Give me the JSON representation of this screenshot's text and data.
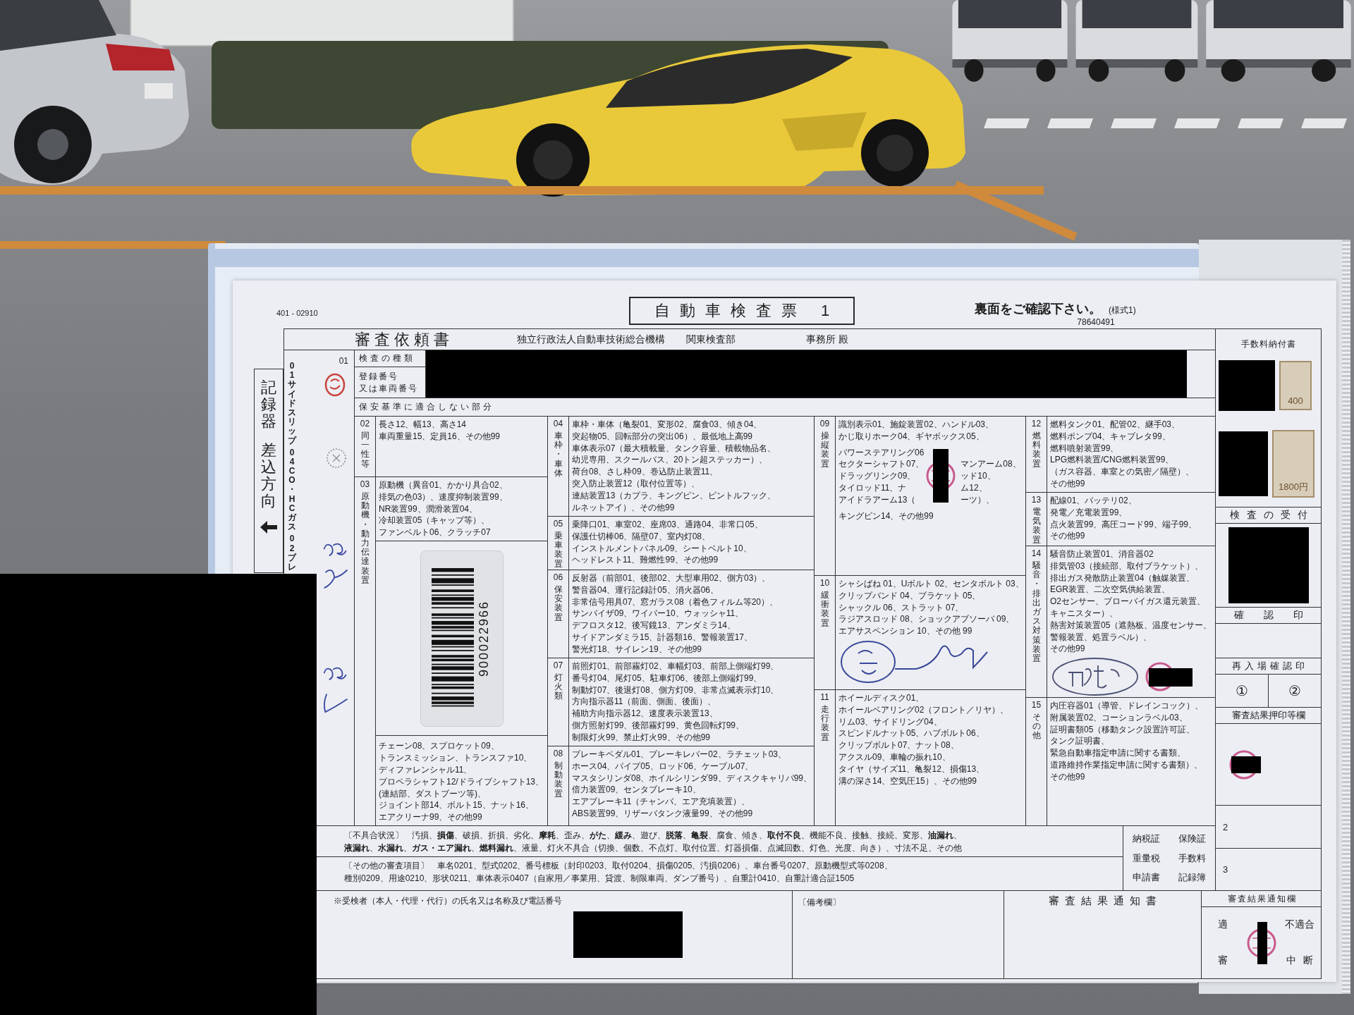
{
  "form": {
    "form_number": "401 - 02910",
    "title": "自動車検査票 1",
    "notice": "裏面をご確認下さい。",
    "style_label": "(様式1)",
    "serial": "78640491"
  },
  "request": {
    "heading": "審査依頼書",
    "agency": "独立行政法人自動車技術総合機構",
    "bureau": "関東検査部",
    "office": "事務所 殿"
  },
  "strip": {
    "label": "記録器",
    "direction": "差込方向"
  },
  "lane": {
    "items": [
      "01サイドスリップ",
      "04CO・HCガス",
      "02ブレ"
    ]
  },
  "inspection": {
    "number": "01",
    "type_label": "検査の種類",
    "registration_label": [
      "登録番号",
      "又は車両番号"
    ]
  },
  "nonconforming_heading": "保安基準に適合しない部分",
  "section_columns": [
    {
      "sections": [
        {
          "kind": "text",
          "code": "02",
          "name": "同一性等",
          "lines": [
            "長さ12、幅13、高さ14",
            "車両重量15、定員16、その他99"
          ]
        },
        {
          "kind": "barcode",
          "code": "03",
          "name": "原動機・動力伝達装置",
          "lines": [
            "原動機（異音01、かかり具合02、",
            "排気の色03）、速度抑制装置99、",
            "NR装置99、潤滑装置04、",
            "冷却装置05（キャップ等）、",
            "ファンベルト06、クラッチ07"
          ],
          "barcode": "900022966",
          "lower_lines": [
            "チェーン08、スプロケット09、",
            "トランスミッション、トランスファ10、",
            "ディファレンシャル11、",
            "プロペラシャフト12/ドライブシャフト13、",
            "(連結部、ダストブーツ等)、",
            "ジョイント部14、ボルト15、ナット16、",
            "エアクリーナ99、その他99"
          ]
        }
      ]
    },
    {
      "sections": [
        {
          "kind": "text",
          "code": "04",
          "name": "車枠・車体",
          "lines": [
            "車枠・車体（亀裂01、変形02、腐食03、傾き04、",
            "突起物05、回転部分の突出06）、最低地上高99",
            "車体表示07（最大積載量、タンク容量、積載物品名、",
            "幼児専用、スクールバス、20トン超ステッカー）、",
            "荷台08、さし枠09、巻込防止装置11、",
            "突入防止装置12（取付位置等）、",
            "連結装置13（カプラ、キングピン、ピントルフック、",
            "ルネットアイ）、その他99"
          ]
        },
        {
          "kind": "text",
          "code": "05",
          "name": "乗車装置",
          "lines": [
            "乗降口01、車室02、座席03、通路04、非常口05、",
            "保護仕切棒06、隔壁07、室内灯08、",
            "インストルメントパネル09、シートベルト10、",
            "ヘッドレスト11、難燃性99、その他99"
          ]
        },
        {
          "kind": "text",
          "code": "06",
          "name": "保安装置",
          "lines": [
            "反射器（前部01、後部02、大型車用02、側方03）、",
            "警音器04、運行記録計05、消火器06、",
            "非常信号用具07、窓ガラス08（着色フィルム等20）、",
            "サンバイザ09、ワイパー10、ウォッシャ11、",
            "デフロスタ12、後写鏡13、アンダミラ14、",
            "サイドアンダミラ15、計器類16、警報装置17、",
            "警光灯18、サイレン19、その他99"
          ]
        },
        {
          "kind": "text",
          "code": "07",
          "name": "灯火類",
          "lines": [
            "前照灯01、前部霧灯02、車幅灯03、前部上側端灯99、",
            "番号灯04、尾灯05、駐車灯06、後部上側端灯99、",
            "制動灯07、後退灯08、側方灯09、非常点滅表示灯10、",
            "方向指示器11（前面、側面、後面）、",
            "補助方向指示器12、速度表示装置13、",
            "側方照射灯99、後部霧灯99、黄色回転灯99、",
            "制限灯火99、禁止灯火99、その他99"
          ]
        },
        {
          "kind": "text",
          "code": "08",
          "name": "制動装置",
          "lines": [
            "ブレーキペダル01、ブレーキレバー02、ラチェット03、",
            "ホース04、パイプ05、ロッド06、ケーブル07、",
            "マスタシリンダ08、ホイルシリンダ99、ディスクキャリパ99、",
            "倍力装置09、センタブレーキ10、",
            "エアブレーキ11（チャンバ、エア充填装置）、",
            "ABS装置99、リザーバタンク液量99、その他99"
          ]
        }
      ]
    },
    {
      "sections": [
        {
          "kind": "stamped",
          "code": "09",
          "name": "操縦装置",
          "lines": [
            "識別表示01、施錠装置02、ハンドル03、",
            "かじ取りホーク04、ギヤボックス05、"
          ],
          "left_lines": [
            "パワーステアリング06",
            "セクターシャフト07、",
            "ドラッグリンク09、",
            "タイロッド11、ナ",
            "アイドラアーム13（"
          ],
          "right_lines": [
            "マンアーム08、",
            "ッド10、",
            "ム12、",
            "ーツ）、"
          ],
          "end_text": "キングピン14、その他99"
        },
        {
          "kind": "signed",
          "code": "10",
          "name": "緩衝装置",
          "lines": [
            "シャシばね 01、Uボルト 02、センタボルト 03、",
            "クリップバンド 04、ブラケット 05、",
            "シャックル 06、ストラット 07、",
            "ラジアスロッド 08、ショックアブソーバ 09、",
            "エアサスペンション 10、その他 99"
          ]
        },
        {
          "kind": "text",
          "code": "11",
          "name": "走行装置",
          "lines": [
            "ホイールディスク01、",
            "ホイールベアリング02（フロント／リヤ）、",
            "リム03、サイドリング04、",
            "スピンドルナット05、ハブボルト06、",
            "クリップボルト07、ナット08、",
            "アクスル09、車輪の振れ10、",
            "タイヤ（サイズ11、亀裂12、損傷13、",
            "溝の深さ14、空気圧15）、その他99"
          ]
        }
      ]
    },
    {
      "sections": [
        {
          "kind": "text",
          "code": "12",
          "name": "燃料装置",
          "lines": [
            "燃料タンク01、配管02、継手03、",
            "燃料ポンプ04、キャブレタ99、",
            "燃料噴射装置99、",
            "LPG燃料装置/CNG燃料装置99、",
            "（ガス容器、車室との気密／隔壁）、",
            "その他99"
          ]
        },
        {
          "kind": "text",
          "code": "13",
          "name": "電気装置",
          "lines": [
            "配線01、バッテリ02、",
            "発電／充電装置99、",
            "点火装置99、高圧コード99、端子99、",
            "その他99"
          ]
        },
        {
          "kind": "signed_stamped",
          "code": "14",
          "name": "騒音・排出ガス対策装置",
          "lines": [
            "騒音防止装置01、消音器02",
            "排気管03（接続部、取付ブラケット）、",
            "排出ガス発散防止装置04（触媒装置、",
            "EGR装置、二次空気供給装置、",
            "O2センサー、ブローバイガス還元装置、",
            "キャニスター）、",
            "熱害対策装置05（遮熱板、温度センサー、",
            "警報装置、処置ラベル）、",
            "その他99"
          ]
        },
        {
          "kind": "text",
          "code": "15",
          "name": "その他",
          "lines": [
            "内圧容器01（導管、ドレインコック）、",
            "附属装置02、コーションラベル03、",
            "証明書類05（移動タンク設置許可証、",
            "タンク証明書、",
            "緊急自動車指定申請に関する書類、",
            "道路維持作業指定申請に関する書類）、",
            "その他99"
          ]
        }
      ]
    }
  ],
  "side": {
    "fee_heading": "手数料納付書",
    "fee_stamps": [
      "400",
      "1800円"
    ],
    "reception": "検査の受付",
    "confirmation": "確認印",
    "reentry": "再入場確認印",
    "reentry_marks": [
      "①",
      "②"
    ],
    "result_stamps": "審査結果押印等欄",
    "row_numbers": [
      "2",
      "3"
    ]
  },
  "bottom": {
    "defects": [
      "〔不具合状況〕　汚損、**損傷**、破損、折損、劣化、**摩耗**、歪み、**がた**、**緩み**、遊び、**脱落**、**亀裂**、腐食、傾き、**取付不良**、機能不良、接触、接続、変形、**油漏れ**、",
      "**液漏れ**、**水漏れ**、**ガス・エア漏れ**、**燃料漏れ**、液量、灯火不具合（切換、個数、不点灯、取付位置、灯器損傷、点滅回数、灯色、光度、向き）、寸法不足、その他"
    ],
    "other_items": [
      "〔その他の審査項目〕　車名0201、型式0202、番号標板（封印0203、取付0204、損傷0205、汚損0206）、車台番号0207、原動機型式等0208、",
      "種別0209、用途0210、形状0211、車体表示0407（自家用／事業用、貸渡、制限車両、ダンプ番号）、自重計0410、自重計適合証1505"
    ],
    "documents": [
      "納税証",
      "保険証",
      "重量税",
      "手数料",
      "申請書",
      "記録簿"
    ],
    "applicant": "※受検者（本人・代理・代行）の氏名又は名称及び電話番号",
    "remarks": "〔備考欄〕",
    "result_notice": "審査結果通知書",
    "result_box": {
      "heading": "審査結果通知欄",
      "pass": "適",
      "fail": "不適合",
      "suspend_start": "審",
      "suspend_end": "中断"
    }
  }
}
